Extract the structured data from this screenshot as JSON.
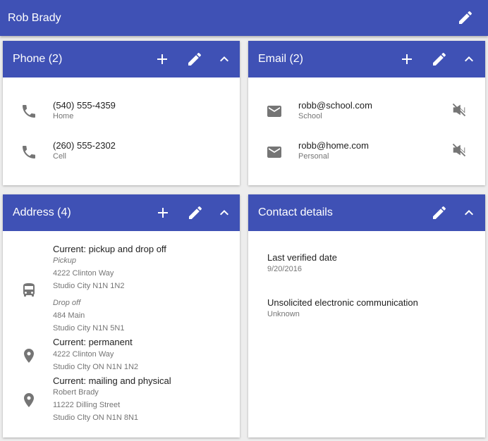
{
  "header": {
    "title": "Rob Brady",
    "edit_icon": "edit-icon"
  },
  "phone": {
    "title": "Phone (2)",
    "items": [
      {
        "number": "(540) 555-4359",
        "type": "Home"
      },
      {
        "number": "(260) 555-2302",
        "type": "Cell"
      }
    ]
  },
  "email": {
    "title": "Email (2)",
    "items": [
      {
        "address": "robb@school.com",
        "type": "School"
      },
      {
        "address": "robb@home.com",
        "type": "Personal"
      }
    ]
  },
  "address": {
    "title": "Address (4)",
    "items": [
      {
        "title": "Current: pickup and drop off",
        "pickup_label": "Pickup",
        "pickup_line1": "4222 Clinton Way",
        "pickup_line2": "Studio City N1N 1N2",
        "dropoff_label": "Drop off",
        "dropoff_line1": "484 Main",
        "dropoff_line2": "Studio City N1N 5N1"
      },
      {
        "title": "Current: permanent",
        "line1": "4222 Clinton Way",
        "line2": "Studio Clty ON N1N 1N2"
      },
      {
        "title": "Current: mailing and physical",
        "line1": "Robert Brady",
        "line2": "11222 Dilling Street",
        "line3": "Studio Clty ON N1N 8N1"
      }
    ]
  },
  "contact_details": {
    "title": "Contact details",
    "last_verified_label": "Last verified date",
    "last_verified_value": "9/20/2016",
    "unsolicited_label": "Unsolicited electronic communication",
    "unsolicited_value": "Unknown"
  },
  "colors": {
    "primary": "#3f51b5",
    "icon_gray": "#757575",
    "background": "#ededed"
  }
}
